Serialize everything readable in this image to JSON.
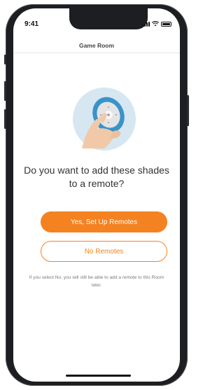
{
  "status_bar": {
    "time": "9:41"
  },
  "nav": {
    "title": "Game Room"
  },
  "dialog": {
    "question": "Do you want to add these shades to a remote?",
    "primary_button": "Yes, Set Up Remotes",
    "secondary_button": "No Remotes",
    "note": "If you select No, you will still be able to add a remote to this Room later."
  },
  "colors": {
    "accent": "#f58220",
    "illustration_circle": "#d6e7f2",
    "remote_blue": "#3a93c9",
    "skin": "#f2c9a8",
    "remote_gray": "#e4e4e4"
  }
}
